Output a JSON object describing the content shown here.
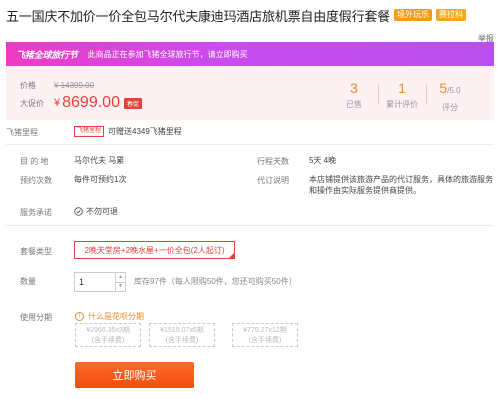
{
  "product": {
    "title": "五一国庆不加价一价全包马尔代夫康迪玛酒店旅机票自由度假行套餐",
    "badges": [
      "境外玩乐",
      "赛拉科"
    ],
    "report": "举报"
  },
  "promo": {
    "tag": "飞猪全球旅行节",
    "text": "此商品正在参加飞猪全球旅行节，请立即购买"
  },
  "price": {
    "original_label": "价格",
    "original": "¥ 14399.00",
    "current_label": "大促价",
    "currency": "¥",
    "current": "8699.00",
    "tag": "春促"
  },
  "stats": [
    {
      "value": "3",
      "label": "已售"
    },
    {
      "value": "1",
      "label": "累计评价"
    },
    {
      "value": "5",
      "suffix": "/5.0",
      "label": "评分"
    }
  ],
  "miles": {
    "label": "飞猪里程",
    "tag": "飞猪里程",
    "text": "可赠送4349飞猪里程"
  },
  "details": {
    "destination_label": "目 的 地",
    "destination": "马尔代夫  马累",
    "duration_label": "行程天数",
    "duration": "5天  4晚",
    "booking_label": "预约次数",
    "booking": "每件可预约1次",
    "agency_label": "代订说明",
    "agency": "本店铺提供该旅游产品的代订服务，具体的旅游服务和操作由实际服务提供商提供。",
    "commitment_label": "服务承诺",
    "commitment": "不勿可退"
  },
  "package": {
    "label": "套餐类型",
    "option": "2晚天堂房+2晚水屋+一价全包(2人起订)"
  },
  "quantity": {
    "label": "数量",
    "value": "1",
    "stock": "库存97件（每人限购50件，您还可购买50件）"
  },
  "installment": {
    "label": "使用分期",
    "hint": "什么是花呗分期",
    "options": [
      {
        "price": "¥2966.35x3期",
        "note": "(含手续费)"
      },
      {
        "price": "¥1515.07x6期",
        "note": "(含手续费)"
      },
      {
        "price": "¥779.27x12期",
        "note": "(含手续费)"
      }
    ]
  },
  "buy_button": "立即购买",
  "colors": {
    "accent": "#e5403b",
    "promo_start": "#ee3ac2",
    "promo_end": "#b84fee",
    "buy_button": "#f34d12",
    "stat_number": "#f08b2b"
  },
  "icons": {
    "commitment": "check-circle-icon",
    "installment_hint": "info-icon",
    "stepper_up": "caret-up-icon",
    "stepper_down": "caret-down-icon"
  }
}
